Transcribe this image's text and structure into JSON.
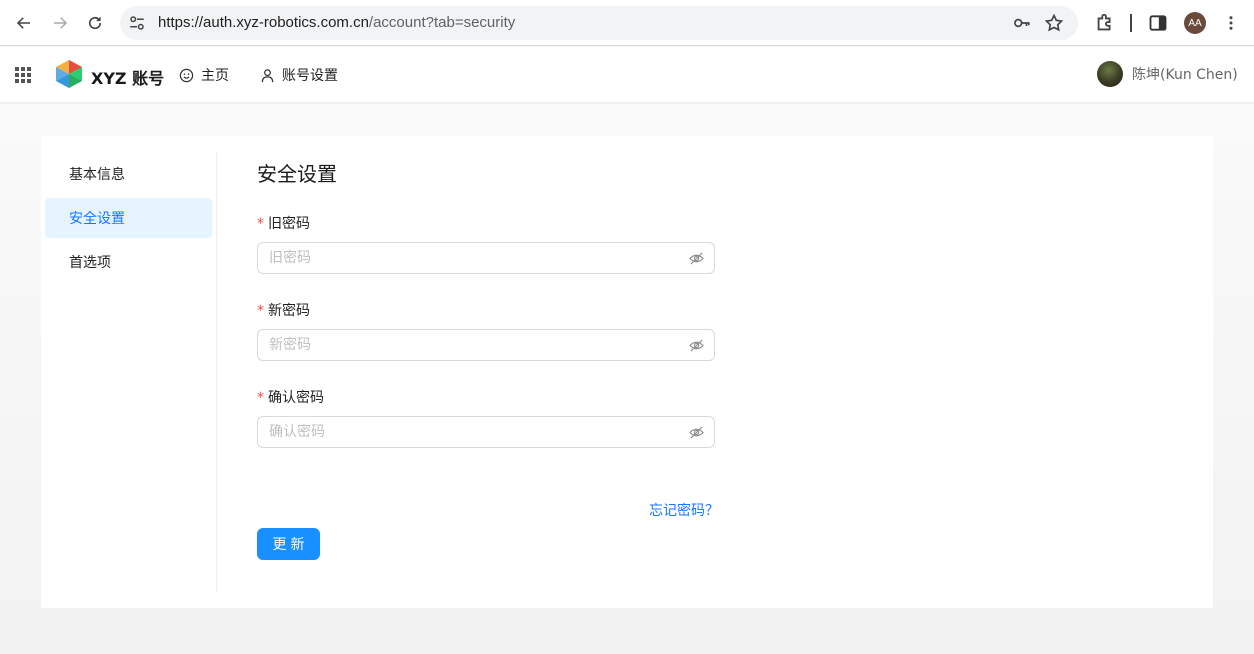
{
  "browser": {
    "url_host": "https://auth.xyz-robotics.com.cn",
    "url_path": "/account?tab=security",
    "profile_initials": "AA"
  },
  "header": {
    "brand": "XYZ 账号",
    "nav": [
      {
        "label": "主页",
        "icon": "smile-icon"
      },
      {
        "label": "账号设置",
        "icon": "user-icon"
      }
    ],
    "user_name": "陈坤(Kun Chen)"
  },
  "sidebar": {
    "items": [
      {
        "label": "基本信息",
        "active": false
      },
      {
        "label": "安全设置",
        "active": true
      },
      {
        "label": "首选项",
        "active": false
      }
    ]
  },
  "form": {
    "title": "安全设置",
    "fields": [
      {
        "label": "旧密码",
        "placeholder": "旧密码",
        "value": "",
        "required": true
      },
      {
        "label": "新密码",
        "placeholder": "新密码",
        "value": "",
        "required": true
      },
      {
        "label": "确认密码",
        "placeholder": "确认密码",
        "value": "",
        "required": true
      }
    ],
    "forgot_link": "忘记密码？",
    "submit_label": "更新"
  },
  "colors": {
    "accent": "#1677ff",
    "button": "#1890ff",
    "required": "#ff4d4f",
    "active_bg": "#e6f4ff"
  }
}
